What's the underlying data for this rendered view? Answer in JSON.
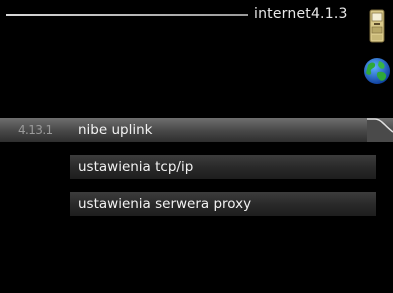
{
  "header": {
    "title": "internet4.1.3"
  },
  "menu": {
    "items": [
      {
        "number": "4.13.1",
        "label": "nibe uplink",
        "selected": true
      },
      {
        "number": "",
        "label": "ustawienia tcp/ip",
        "selected": false
      },
      {
        "number": "",
        "label": "ustawienia serwera proxy",
        "selected": false
      }
    ]
  },
  "icons": {
    "device": "thermostat-device-icon",
    "globe": "globe-icon"
  },
  "colors": {
    "background": "#000000",
    "selected_bar": "#6e6e6e",
    "normal_bar": "#2a2a2a",
    "text": "#f2f2f2"
  }
}
